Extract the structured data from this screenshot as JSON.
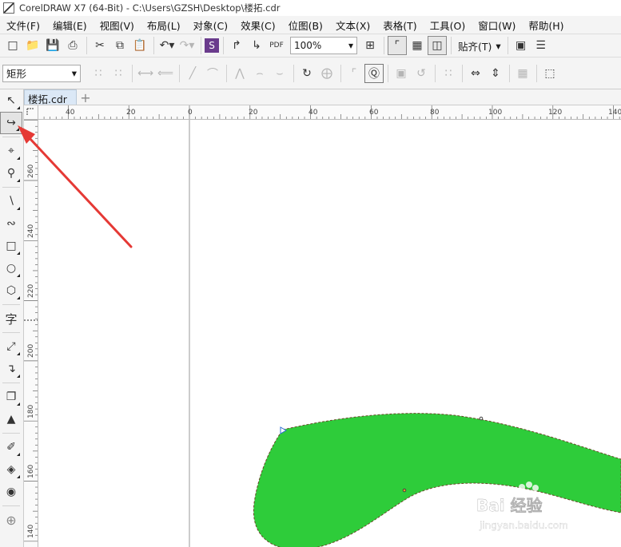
{
  "window": {
    "title": "CorelDRAW X7 (64-Bit) - C:\\Users\\GZSH\\Desktop\\楼拓.cdr"
  },
  "menu": [
    "文件(F)",
    "编辑(E)",
    "视图(V)",
    "布局(L)",
    "对象(C)",
    "效果(C)",
    "位图(B)",
    "文本(X)",
    "表格(T)",
    "工具(O)",
    "窗口(W)",
    "帮助(H)"
  ],
  "toolbar": {
    "zoom_value": "100%",
    "snap_label": "贴齐(T)"
  },
  "property_bar": {
    "shape_type": "矩形"
  },
  "document": {
    "tab_label": "楼拓.cdr",
    "add_tab_glyph": "+"
  },
  "rulers": {
    "horizontal_labels": [
      "40",
      "20",
      "0",
      "20",
      "40",
      "60",
      "80",
      "100",
      "120",
      "140"
    ],
    "vertical_labels": [
      "260",
      "240",
      "220",
      "200",
      "180",
      "160",
      "140"
    ]
  },
  "watermark": {
    "logo_text": "Bai 经验",
    "url": "jingyan.baidu.com"
  },
  "colors": {
    "shape_fill": "#2ecc3a",
    "arrow": "#e53935",
    "tab_active": "#dbe8f6"
  }
}
